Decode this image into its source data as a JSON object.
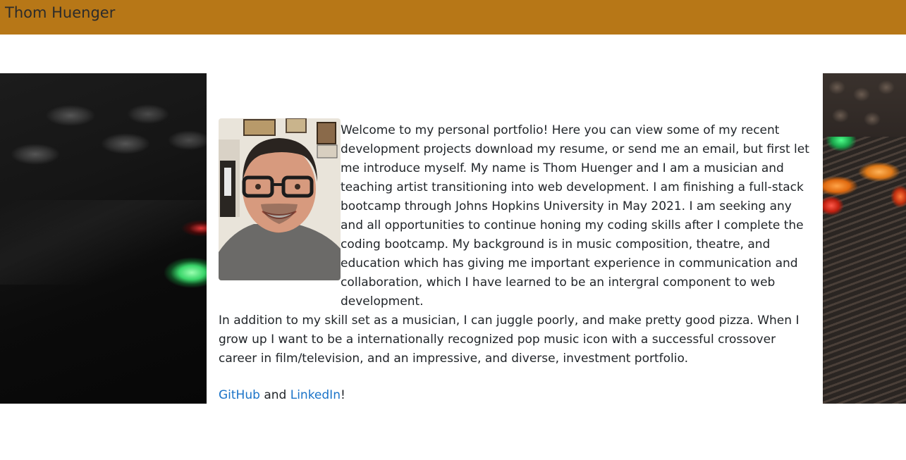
{
  "navbar": {
    "brand": "Thom Huenger"
  },
  "about": {
    "photo_icon": "profile-photo",
    "intro": "Welcome to my personal portfolio! Here you can view some of my recent development projects download my resume, or send me an email, but first let me introduce myself. My name is Thom Huenger and I am a musician and teaching artist transitioning into web development. I am finishing a full-stack bootcamp through Johns Hopkins University in May 2021. I am seeking any and all opportunities to continue honing my coding skills after I complete the coding bootcamp. My background is in music composition, theatre, and education which has giving me important experience in communication and collaboration, which I have learned to be an intergral component to web development.",
    "paragraph2": "In addition to my skill set as a musician, I can juggle poorly, and make pretty good pizza. When I grow up I want to be a internationally recognized pop music icon with a successful crossover career in film/television, and an impressive, and diverse, investment portfolio.",
    "github_label": "GitHub",
    "and_text": " and ",
    "linkedin_label": "LinkedIn",
    "exclaim": "!"
  },
  "colors": {
    "navbar_bg": "#b77717",
    "link": "#1a73c8"
  }
}
